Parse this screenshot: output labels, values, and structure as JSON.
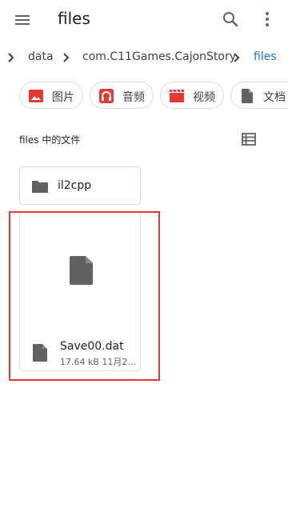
{
  "appbar": {
    "title": "files",
    "menu_icon": "menu-icon",
    "search_icon": "search-icon",
    "more_icon": "more-vert-icon"
  },
  "breadcrumb": {
    "items": [
      "data",
      "com.C11Games.CajonStory",
      "files"
    ],
    "active_color": "#1a73e8"
  },
  "chips": [
    {
      "label": "图片",
      "icon": "image-icon",
      "color": "#e53935"
    },
    {
      "label": "音频",
      "icon": "headphones-icon",
      "color": "#e53935"
    },
    {
      "label": "视频",
      "icon": "video-clapper-icon",
      "color": "#e53935"
    },
    {
      "label": "文档",
      "icon": "document-icon",
      "color": "#616161"
    }
  ],
  "section": {
    "title": "files 中的文件",
    "view_icon": "list-view-icon"
  },
  "folders": [
    {
      "name": "il2cpp",
      "icon": "folder-icon"
    }
  ],
  "files": [
    {
      "name": "Save00.dat",
      "meta": "17.64 kB 11月2…",
      "icon": "file-icon"
    }
  ],
  "colors": {
    "accent": "#1a73e8",
    "highlight": "#e53935",
    "icon_gray": "#616161"
  }
}
